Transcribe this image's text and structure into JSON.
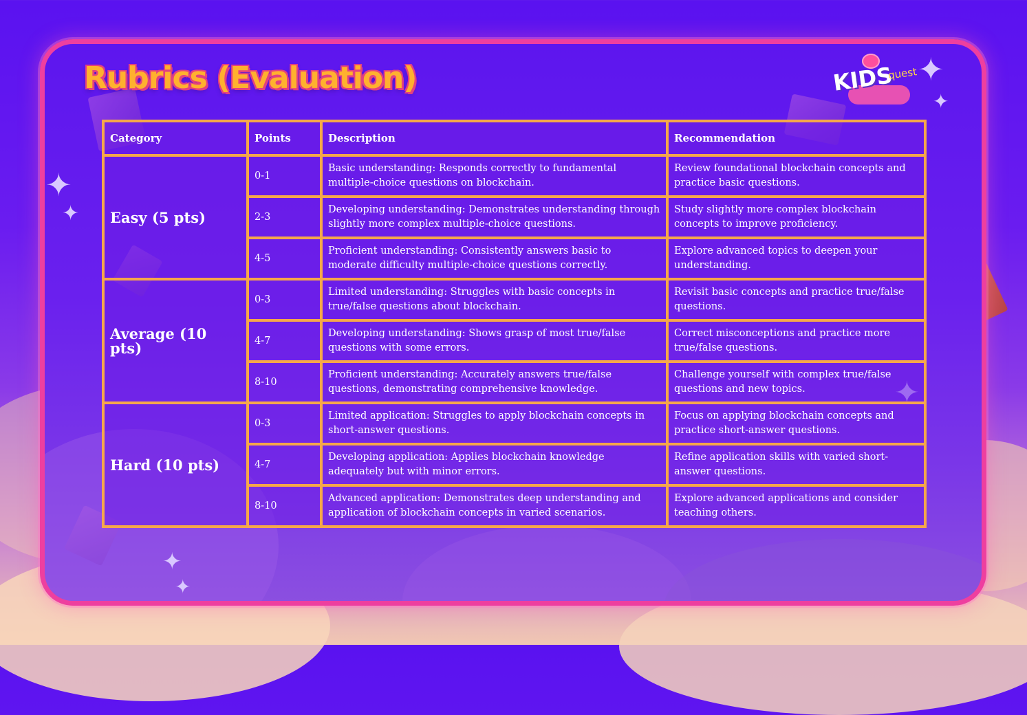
{
  "title": "Rubrics (Evaluation)",
  "logo": {
    "main": "KIDS",
    "sub": "quest"
  },
  "table": {
    "headers": [
      "Category",
      "Points",
      "Description",
      "Recommendation"
    ],
    "groups": [
      {
        "category": "Easy (5 pts)",
        "rows": [
          {
            "points": "0-1",
            "description": "Basic understanding: Responds correctly to fundamental multiple-choice questions on blockchain.",
            "recommendation": "Review foundational blockchain concepts and practice basic questions."
          },
          {
            "points": "2-3",
            "description": "Developing understanding: Demonstrates understanding through slightly more complex multiple-choice questions.",
            "recommendation": "Study slightly more complex blockchain concepts to improve proficiency."
          },
          {
            "points": "4-5",
            "description": "Proficient understanding: Consistently answers basic to moderate difficulty multiple-choice questions correctly.",
            "recommendation": "Explore advanced topics to deepen your understanding."
          }
        ]
      },
      {
        "category": "Average (10 pts)",
        "rows": [
          {
            "points": "0-3",
            "description": "Limited understanding: Struggles with basic concepts in true/false questions about blockchain.",
            "recommendation": "Revisit basic concepts and practice true/false questions."
          },
          {
            "points": "4-7",
            "description": "Developing understanding: Shows grasp of most true/false questions with some errors.",
            "recommendation": "Correct misconceptions and practice more true/false questions."
          },
          {
            "points": "8-10",
            "description": "Proficient understanding: Accurately answers true/false questions, demonstrating comprehensive knowledge.",
            "recommendation": "Challenge yourself with complex true/false questions and new topics."
          }
        ]
      },
      {
        "category": "Hard (10 pts)",
        "rows": [
          {
            "points": "0-3",
            "description": "Limited application: Struggles to apply blockchain concepts in short-answer questions.",
            "recommendation": "Focus on applying blockchain concepts and practice short-answer questions."
          },
          {
            "points": "4-7",
            "description": "Developing application: Applies blockchain knowledge adequately but with minor errors.",
            "recommendation": "Refine application skills with varied short-answer questions."
          },
          {
            "points": "8-10",
            "description": "Advanced application: Demonstrates deep understanding and application of blockchain concepts in varied scenarios.",
            "recommendation": "Explore advanced applications and consider teaching others."
          }
        ]
      }
    ]
  },
  "colors": {
    "background": "#5a12f0",
    "frame_border": "#ee3f9f",
    "table_border": "#f6a74a",
    "title_fill": "#ffb12e",
    "title_outline": "#e2417f"
  },
  "icons": [
    "sparkle-icon",
    "book-icon",
    "planet-icon"
  ]
}
